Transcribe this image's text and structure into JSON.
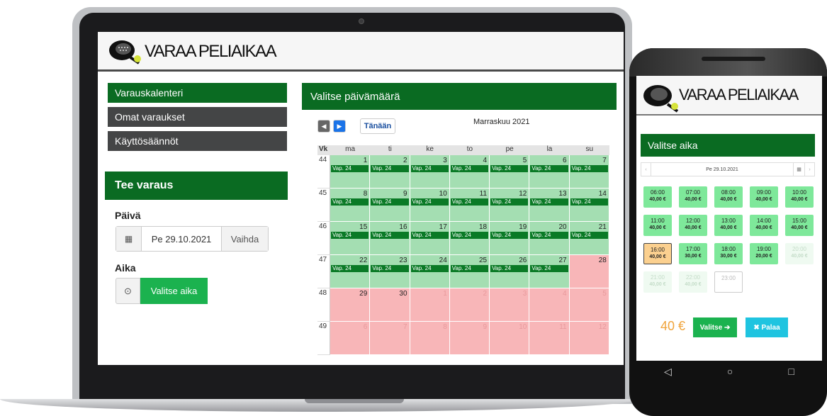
{
  "brand": {
    "name": "VARAA PELIAIKAA"
  },
  "nav": [
    {
      "label": "Varauskalenteri",
      "active": true
    },
    {
      "label": "Omat varaukset",
      "active": false
    },
    {
      "label": "Käyttösäännöt",
      "active": false
    }
  ],
  "booking": {
    "title": "Tee varaus",
    "day_label": "Päivä",
    "date_value": "Pe 29.10.2021",
    "change_label": "Vaihda",
    "time_label": "Aika",
    "choose_time_label": "Valitse aika"
  },
  "calendar": {
    "header": "Valitse päivämäärä",
    "today_label": "Tänään",
    "month_title": "Marraskuu 2021",
    "week_header": "Vk",
    "weekdays": [
      "ma",
      "ti",
      "ke",
      "to",
      "pe",
      "la",
      "su"
    ],
    "slot_label": "Vap. 24",
    "colors": {
      "available": "#a4deb2",
      "unavailable": "#f8b6b8",
      "badge": "#0a7a26"
    },
    "weeks": [
      {
        "week": "44",
        "days": [
          "1",
          "2",
          "3",
          "4",
          "5",
          "6",
          "7"
        ],
        "status": [
          "a",
          "a",
          "a",
          "a",
          "a",
          "a",
          "a"
        ]
      },
      {
        "week": "45",
        "days": [
          "8",
          "9",
          "10",
          "11",
          "12",
          "13",
          "14"
        ],
        "status": [
          "a",
          "a",
          "a",
          "a",
          "a",
          "a",
          "a"
        ]
      },
      {
        "week": "46",
        "days": [
          "15",
          "16",
          "17",
          "18",
          "19",
          "20",
          "21"
        ],
        "status": [
          "a",
          "a",
          "a",
          "a",
          "a",
          "a",
          "a"
        ]
      },
      {
        "week": "47",
        "days": [
          "22",
          "23",
          "24",
          "25",
          "26",
          "27",
          "28"
        ],
        "status": [
          "a",
          "a",
          "a",
          "a",
          "a",
          "a",
          "r"
        ]
      },
      {
        "week": "48",
        "days": [
          "29",
          "30",
          "1",
          "2",
          "3",
          "4",
          "5"
        ],
        "status": [
          "r",
          "r",
          "o",
          "o",
          "o",
          "o",
          "o"
        ]
      },
      {
        "week": "49",
        "days": [
          "6",
          "7",
          "8",
          "9",
          "10",
          "11",
          "12"
        ],
        "status": [
          "o",
          "o",
          "o",
          "o",
          "o",
          "o",
          "o"
        ]
      }
    ]
  },
  "mobile": {
    "header": "Valitse aika",
    "date_value": "Pe 29.10.2021",
    "slots": [
      {
        "time": "06:00",
        "price": "40,00 €",
        "state": "avail"
      },
      {
        "time": "07:00",
        "price": "40,00 €",
        "state": "avail"
      },
      {
        "time": "08:00",
        "price": "40,00 €",
        "state": "avail"
      },
      {
        "time": "09:00",
        "price": "40,00 €",
        "state": "avail"
      },
      {
        "time": "10:00",
        "price": "40,00 €",
        "state": "avail"
      },
      {
        "time": "11:00",
        "price": "40,00 €",
        "state": "avail"
      },
      {
        "time": "12:00",
        "price": "40,00 €",
        "state": "avail"
      },
      {
        "time": "13:00",
        "price": "40,00 €",
        "state": "avail"
      },
      {
        "time": "14:00",
        "price": "40,00 €",
        "state": "avail"
      },
      {
        "time": "15:00",
        "price": "40,00 €",
        "state": "avail"
      },
      {
        "time": "16:00",
        "price": "40,00 €",
        "state": "selected"
      },
      {
        "time": "17:00",
        "price": "30,00 €",
        "state": "avail"
      },
      {
        "time": "18:00",
        "price": "30,00 €",
        "state": "avail"
      },
      {
        "time": "19:00",
        "price": "20,00 €",
        "state": "avail"
      },
      {
        "time": "20:00",
        "price": "40,00 €",
        "state": "disabled"
      },
      {
        "time": "21:00",
        "price": "40,00 €",
        "state": "disabled"
      },
      {
        "time": "22:00",
        "price": "40,00 €",
        "state": "disabled"
      },
      {
        "time": "23:00",
        "price": "",
        "state": "empty"
      }
    ],
    "total": "40 €",
    "select_label": "Valitse ➔",
    "back_label": "✖ Palaa"
  }
}
